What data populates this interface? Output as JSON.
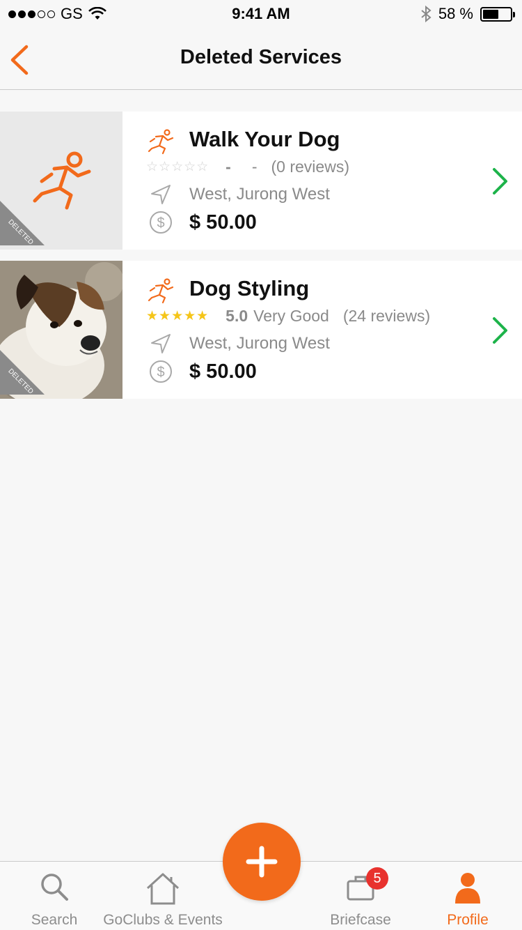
{
  "status_bar": {
    "carrier": "GS",
    "time": "9:41 AM",
    "battery_percent": "58 %",
    "battery_level": 0.58
  },
  "nav": {
    "title": "Deleted Services",
    "back_icon": "chevron-left-icon"
  },
  "accent_color": "#f26a1b",
  "services": [
    {
      "title": "Walk Your Dog",
      "badge": "DELETED",
      "stars": "☆☆☆☆☆",
      "score": "-",
      "score_word": "-",
      "reviews": "(0 reviews)",
      "location": "West, Jurong West",
      "price": "$ 50.00",
      "thumbnail": "runner-icon"
    },
    {
      "title": "Dog Styling",
      "badge": "DELETED",
      "stars": "★★★★★",
      "score": "5.0",
      "score_word": "Very Good",
      "reviews": "(24 reviews)",
      "location": "West, Jurong West",
      "price": "$ 50.00",
      "thumbnail": "dog-photo"
    }
  ],
  "fab": {
    "icon": "plus-icon"
  },
  "tabs": [
    {
      "label": "Search",
      "icon": "search-icon"
    },
    {
      "label": "GoClubs & Events",
      "icon": "home-icon"
    },
    {
      "label": "Briefcase",
      "icon": "briefcase-icon",
      "badge": "5"
    },
    {
      "label": "Profile",
      "icon": "profile-icon",
      "active": true
    }
  ]
}
